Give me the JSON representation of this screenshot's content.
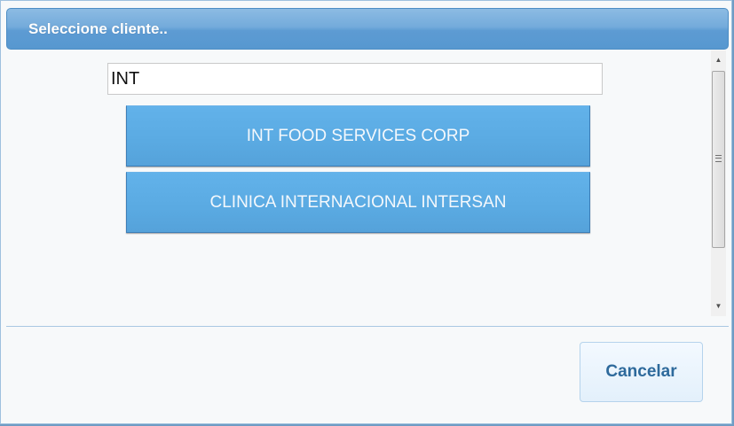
{
  "dialog": {
    "title": "Seleccione cliente.."
  },
  "search": {
    "value": "INT",
    "placeholder": ""
  },
  "clients": [
    {
      "label": "INT FOOD SERVICES CORP"
    },
    {
      "label": "CLINICA INTERNACIONAL INTERSAN"
    }
  ],
  "footer": {
    "cancel_label": "Cancelar"
  },
  "scrollbar": {
    "up_icon": "arrow-up-icon",
    "down_icon": "arrow-down-icon",
    "grip_icon": "grip-icon"
  },
  "colors": {
    "titlebar": "#74abdb",
    "client_button": "#5aaae2",
    "cancel_text": "#2e6a9c"
  }
}
